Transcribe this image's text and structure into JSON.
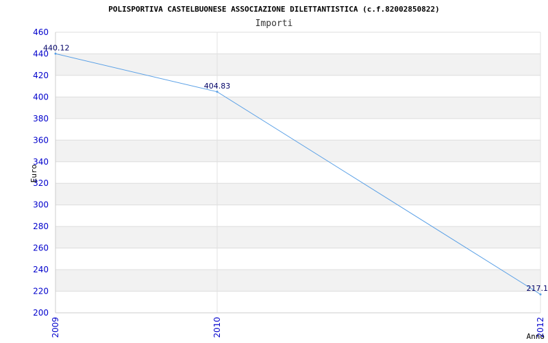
{
  "chart_data": {
    "type": "line",
    "title": "POLISPORTIVA CASTELBUONESE ASSOCIAZIONE DILETTANTISTICA (c.f.82002850822)",
    "subtitle": "Importi",
    "xlabel": "Anno",
    "ylabel": "Euro",
    "x": [
      "2009",
      "2010",
      "2012"
    ],
    "series": [
      {
        "values": [
          440.12,
          404.83,
          217.1
        ],
        "labels": [
          "440.12",
          "404.83",
          "217.1"
        ]
      }
    ],
    "ylim": [
      200,
      460
    ],
    "yticks": [
      200,
      220,
      240,
      260,
      280,
      300,
      320,
      340,
      360,
      380,
      400,
      420,
      440,
      460
    ],
    "grid": true,
    "colors": {
      "line": "#5aa0e6",
      "band": "#f2f2f2",
      "grid": "#dddddd",
      "tick_text": "#0000cc",
      "data_label": "#000066"
    }
  }
}
